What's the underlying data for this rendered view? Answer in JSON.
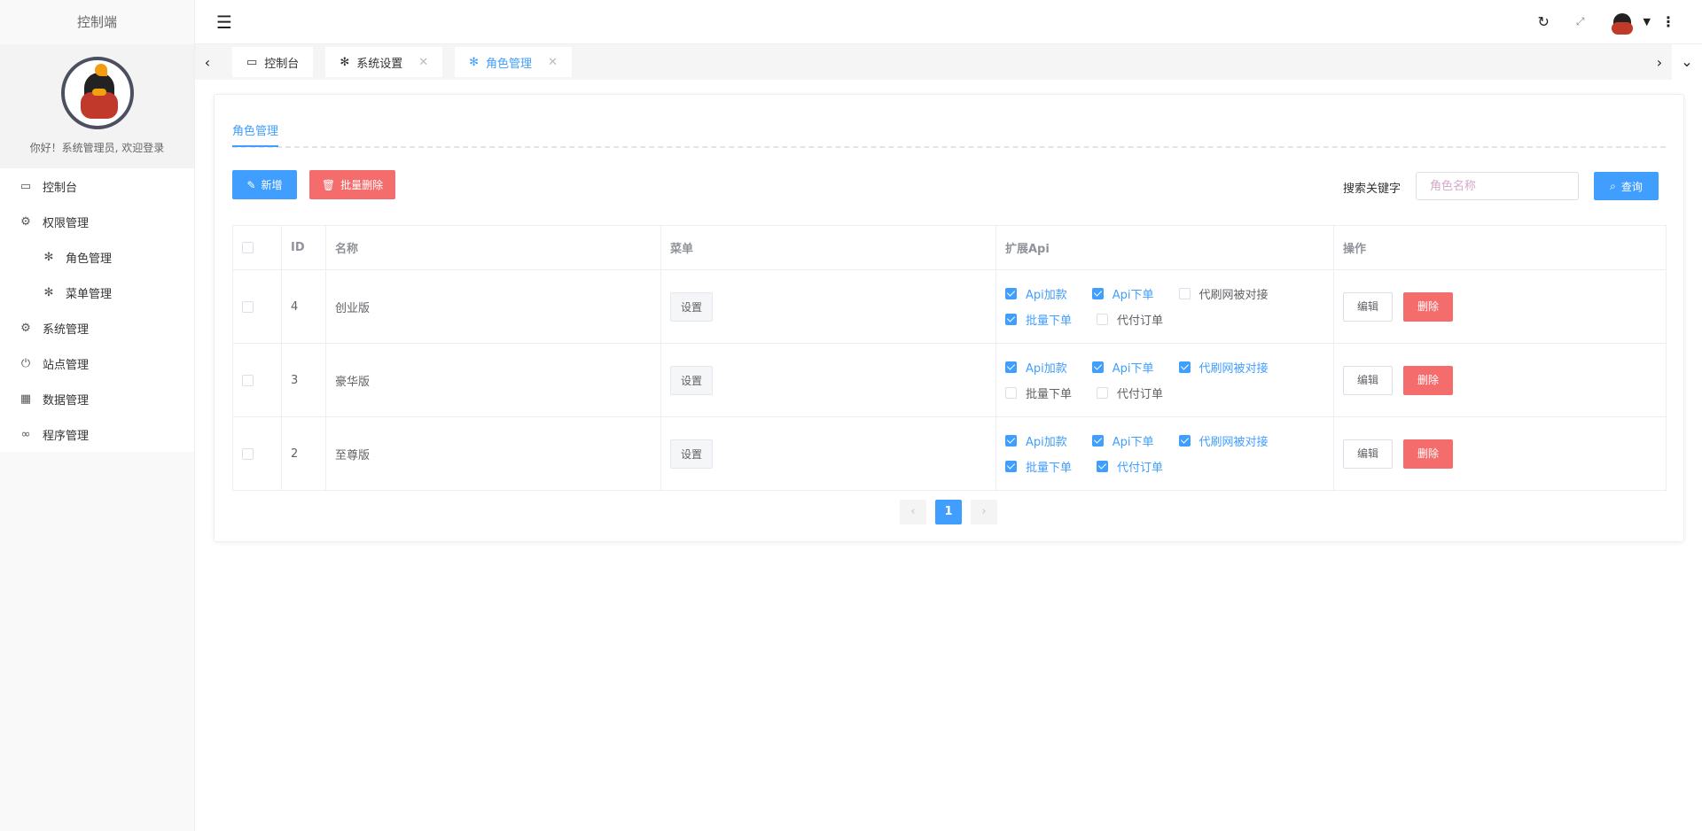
{
  "sidebar": {
    "title": "控制端",
    "greeting": "你好！系统管理员, 欢迎登录",
    "items": [
      {
        "label": "控制台",
        "icon": "monitor-icon"
      },
      {
        "label": "权限管理",
        "icon": "gear-icon"
      },
      {
        "label": "角色管理",
        "icon": "palm-icon"
      },
      {
        "label": "菜单管理",
        "icon": "palm-icon"
      },
      {
        "label": "系统管理",
        "icon": "gear-icon"
      },
      {
        "label": "站点管理",
        "icon": "power-icon"
      },
      {
        "label": "数据管理",
        "icon": "grid-icon"
      },
      {
        "label": "程序管理",
        "icon": "link-icon"
      }
    ]
  },
  "tabs": [
    {
      "label": "控制台"
    },
    {
      "label": "系统设置"
    },
    {
      "label": "角色管理"
    }
  ],
  "page": {
    "tab": "角色管理",
    "add": "新增",
    "batch_delete": "批量删除",
    "search_label": "搜索关键字",
    "search_placeholder": "角色名称",
    "search_value": "",
    "query": "查询"
  },
  "table": {
    "headers": [
      "ID",
      "名称",
      "菜单",
      "扩展Api",
      "操作"
    ],
    "rows": [
      {
        "id": "4",
        "name": "创业版",
        "menu": "设置",
        "apis": [
          {
            "label": "Api加款",
            "checked": true
          },
          {
            "label": "Api下单",
            "checked": true
          },
          {
            "label": "代刷网被对接",
            "checked": false
          },
          {
            "label": "批量下单",
            "checked": true
          },
          {
            "label": "代付订单",
            "checked": false
          }
        ],
        "edit": "编辑",
        "delete": "删除"
      },
      {
        "id": "3",
        "name": "豪华版",
        "menu": "设置",
        "apis": [
          {
            "label": "Api加款",
            "checked": true
          },
          {
            "label": "Api下单",
            "checked": true
          },
          {
            "label": "代刷网被对接",
            "checked": true
          },
          {
            "label": "批量下单",
            "checked": false
          },
          {
            "label": "代付订单",
            "checked": false
          }
        ],
        "edit": "编辑",
        "delete": "删除"
      },
      {
        "id": "2",
        "name": "至尊版",
        "menu": "设置",
        "apis": [
          {
            "label": "Api加款",
            "checked": true
          },
          {
            "label": "Api下单",
            "checked": true
          },
          {
            "label": "代刷网被对接",
            "checked": true
          },
          {
            "label": "批量下单",
            "checked": true
          },
          {
            "label": "代付订单",
            "checked": true
          }
        ],
        "edit": "编辑",
        "delete": "删除"
      }
    ]
  },
  "pagination": {
    "prev": "‹",
    "current": "1",
    "next": "›"
  },
  "colors": {
    "primary": "#409eff",
    "danger": "#f56c6c"
  }
}
